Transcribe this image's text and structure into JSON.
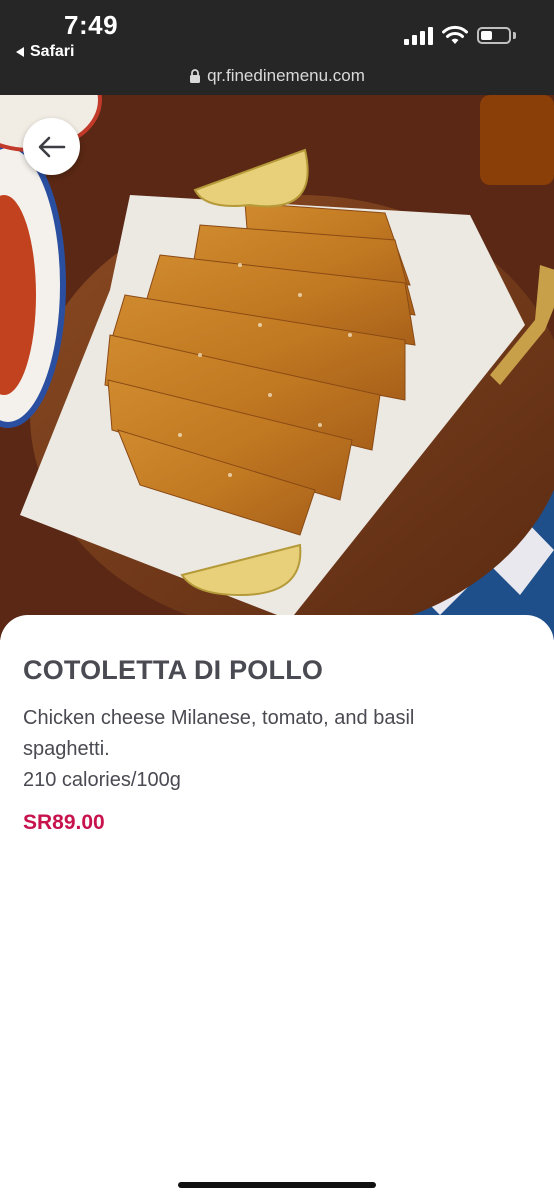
{
  "status": {
    "time": "7:49",
    "back_app": "Safari",
    "url": "qr.finedinemenu.com"
  },
  "icons": {
    "back": "arrow-left-icon",
    "signal": "cellular-signal-icon",
    "wifi": "wifi-icon",
    "battery": "battery-icon",
    "lock": "lock-icon"
  },
  "item": {
    "name": "COTOLETTA DI POLLO",
    "description_line1": "Chicken cheese Milanese, tomato, and basil",
    "description_line2": "spaghetti.",
    "calories": "210 calories/100g",
    "price": "SR89.00"
  },
  "colors": {
    "price": "#c8124e",
    "text": "#4a4a52",
    "statusbar": "#262626"
  }
}
